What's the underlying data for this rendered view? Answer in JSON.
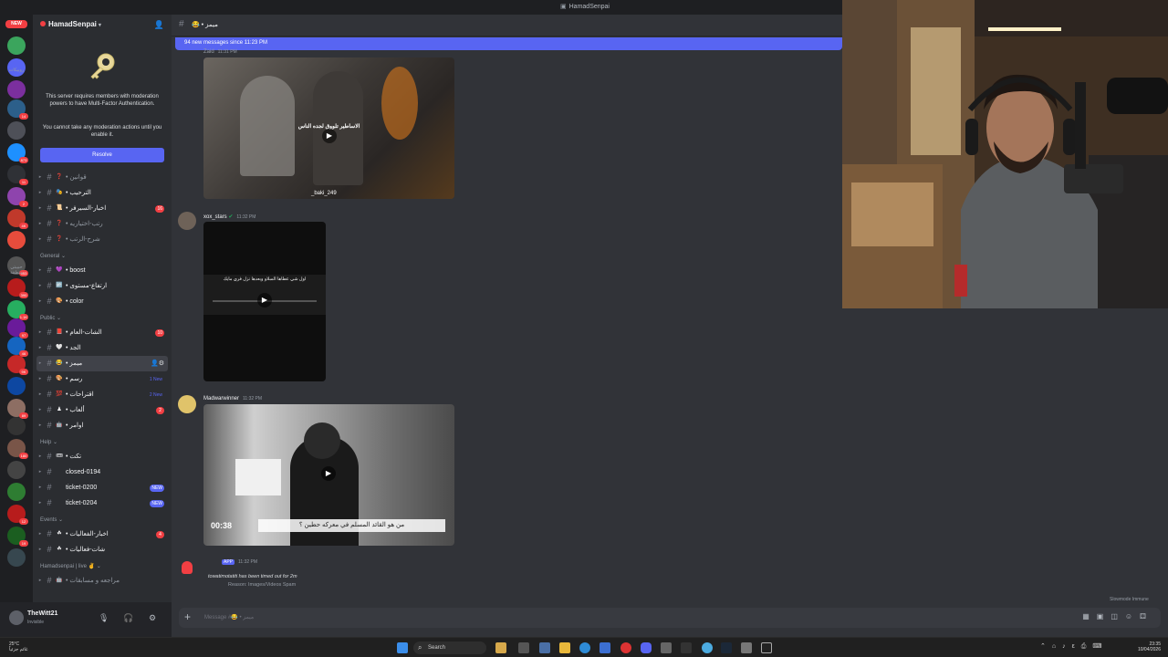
{
  "window": {
    "title": "HamadSenpai"
  },
  "rail": {
    "new_badge": "NEW",
    "labels": [
      "روبيكات",
      "حبيبتي منطقة"
    ],
    "servers": [
      {
        "color": "#3ba55d",
        "badge": ""
      },
      {
        "color": "#5865f2",
        "badge": ""
      },
      {
        "color": "#7b2f9e",
        "badge": ""
      },
      {
        "color": "#2c5f8a",
        "badge": "14"
      },
      {
        "color": "#4e5058",
        "badge": ""
      },
      {
        "color": "#1e90ff",
        "badge": "873"
      },
      {
        "color": "#2f3136",
        "badge": "11"
      },
      {
        "color": "#8e44ad",
        "badge": "2"
      },
      {
        "color": "#c0392b",
        "badge": "4K"
      },
      {
        "color": "#e74c3c",
        "badge": ""
      },
      {
        "color": "#555",
        "badge": "953"
      },
      {
        "color": "#b71c1c",
        "badge": "390"
      },
      {
        "color": "#27ae60",
        "badge": "1.1K"
      },
      {
        "color": "#6a1b9a",
        "badge": "97"
      },
      {
        "color": "#1565c0",
        "badge": "46"
      },
      {
        "color": "#c62828",
        "badge": "9K"
      },
      {
        "color": "#0d47a1",
        "badge": ""
      },
      {
        "color": "#8d6e63",
        "badge": "89"
      },
      {
        "color": "#333",
        "badge": ""
      },
      {
        "color": "#795548",
        "badge": "180"
      },
      {
        "color": "#444",
        "badge": ""
      },
      {
        "color": "#2e7d32",
        "badge": ""
      },
      {
        "color": "#b71c1c",
        "badge": "12"
      },
      {
        "color": "#1b5e20",
        "badge": "19"
      },
      {
        "color": "#37474f",
        "badge": ""
      }
    ]
  },
  "sidebar": {
    "server_name": "HamadSenpai",
    "mfa_message": "This server requires members with moderation powers to have Multi-Factor Authentication.",
    "mfa_message2": "You cannot take any moderation actions until you enable it.",
    "resolve_label": "Resolve",
    "groups": [
      {
        "category": "",
        "channels": [
          {
            "emoji": "❓",
            "name": "قوانين",
            "state": "dim",
            "badge": ""
          },
          {
            "emoji": "🎭",
            "name": "الترحيب",
            "state": "bright",
            "badge": ""
          },
          {
            "emoji": "📜",
            "name": "اخبار-السيرفر",
            "state": "bright",
            "badge": "16"
          },
          {
            "emoji": "❓",
            "name": "رتب-اختياريه",
            "state": "dim",
            "badge": ""
          },
          {
            "emoji": "❓",
            "name": "شرح-الرتب",
            "state": "dim",
            "badge": ""
          }
        ]
      },
      {
        "category": "General",
        "channels": [
          {
            "emoji": "💜",
            "name": "boost",
            "state": "bright",
            "badge": ""
          },
          {
            "emoji": "🆙",
            "name": "ارتفاع-مستوى",
            "state": "bright",
            "badge": ""
          },
          {
            "emoji": "🎨",
            "name": "color",
            "state": "bright",
            "badge": ""
          }
        ]
      },
      {
        "category": "Public",
        "channels": [
          {
            "emoji": "📕",
            "name": "الشات-العام",
            "state": "bright",
            "badge": "10"
          },
          {
            "emoji": "🤍",
            "name": "الجد",
            "state": "bright",
            "badge": ""
          },
          {
            "emoji": "😂",
            "name": "ميمز",
            "state": "active",
            "badge": ""
          },
          {
            "emoji": "🎨",
            "name": "رسم",
            "state": "bright",
            "badge": "1 New"
          },
          {
            "emoji": "💯",
            "name": "اقتراحات",
            "state": "bright",
            "badge": "2 New"
          },
          {
            "emoji": "♟",
            "name": "ألعاب",
            "state": "bright",
            "badge": "2"
          },
          {
            "emoji": "🤖",
            "name": "اوامر",
            "state": "bright",
            "badge": ""
          }
        ]
      },
      {
        "category": "Help",
        "channels": [
          {
            "emoji": "🎟",
            "name": "تكت",
            "state": "bright",
            "badge": ""
          },
          {
            "emoji": "",
            "name": "closed-0194",
            "state": "bright",
            "badge": ""
          },
          {
            "emoji": "",
            "name": "ticket-0200",
            "state": "bright",
            "badge": "NEW"
          },
          {
            "emoji": "",
            "name": "ticket-0204",
            "state": "bright",
            "badge": "NEW"
          }
        ]
      },
      {
        "category": "Events",
        "channels": [
          {
            "emoji": "☘",
            "name": "اخبار-الفعاليات",
            "state": "bright",
            "badge": "4"
          },
          {
            "emoji": "☘",
            "name": "شات-فعاليات",
            "state": "bright",
            "badge": ""
          }
        ]
      },
      {
        "category": "Hamadsenpai | live ✌",
        "channels": [
          {
            "emoji": "🤖",
            "name": "مراجعه و مسابقات",
            "state": "dim",
            "badge": ""
          }
        ]
      }
    ]
  },
  "user": {
    "name": "TheWitt21",
    "status": "Invisible"
  },
  "channel": {
    "name": "ميمز"
  },
  "new_messages": "94 new messages since 11:23 PM",
  "messages": [
    {
      "author": "Zaid",
      "time": "11:31 PM",
      "caption": "_baki_249",
      "overlay": "الاساطير تلووق لجده الناس"
    },
    {
      "author": "xox_stars",
      "time": "11:32 PM",
      "overlay": "اول شي عطاها السلاو وبعدها نزل فري مايك"
    },
    {
      "author": "Madwarwinner",
      "time": "11:32 PM",
      "duration": "00:38",
      "overlay": "من هو القائد المسلم في معركه حطين ؟"
    },
    {
      "author": "APP",
      "time": "11:32 PM",
      "system_text": "towatimotatiti has been timed out for 2m",
      "reason": "Reason: Images/Videos Spam"
    }
  ],
  "composer": {
    "placeholder": "Message #😂 • ميمز"
  },
  "slowmode": "Slowmode Immune",
  "taskbar": {
    "weather_temp": "25°C",
    "weather_desc": "غائم جزئياً",
    "search": "Search",
    "time": "23:35",
    "date": "10/04/2026"
  }
}
